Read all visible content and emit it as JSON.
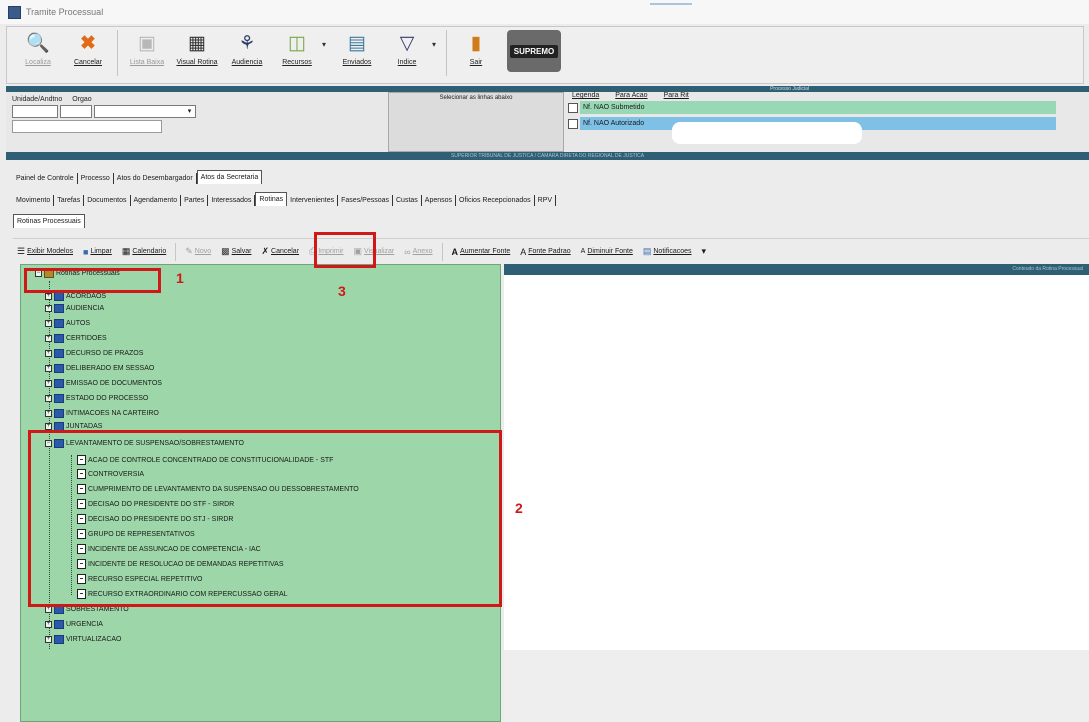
{
  "window": {
    "title": "Tramite Processual"
  },
  "toolbar": {
    "buttons": [
      {
        "label": "Localiza",
        "icon": "magnifier-doc-icon",
        "disabled": true
      },
      {
        "label": "Cancelar",
        "icon": "red-x-icon",
        "disabled": false
      },
      {
        "label": "Lista Baixa",
        "icon": "books-icon",
        "disabled": true
      },
      {
        "label": "Visual Rotina",
        "icon": "document-view-icon",
        "disabled": false
      },
      {
        "label": "Audiencia",
        "icon": "people-icon",
        "disabled": false
      },
      {
        "label": "Recursos",
        "icon": "folders-icon",
        "disabled": false
      },
      {
        "label": "Enviados",
        "icon": "send-document-icon",
        "disabled": false
      },
      {
        "label": "Indice",
        "icon": "funnel-icon",
        "disabled": false
      },
      {
        "label": "Sair",
        "icon": "exit-door-icon",
        "disabled": false
      }
    ],
    "logo_text": "SUPREMO"
  },
  "header": {
    "banner": "Processo Judicial",
    "labels": [
      "Unidade/Andtno",
      "Orgao"
    ],
    "mid_header": "Selecionar as linhas abaixo",
    "legend_cols": [
      "Legenda",
      "Para Acao",
      "Para Rit"
    ],
    "legend_rows": [
      "Nf. NAO Submetido",
      "Nf. NAO Autorizado"
    ]
  },
  "band_text": "SUPERIOR TRIBUNAL DE JUSTICA / CAMARA DIRETA DO REGIONAL DE JUSTICA",
  "tabs_row1": [
    "Painel de Controle",
    "Processo",
    "Atos do Desembargador",
    "Atos da Secretaria"
  ],
  "tabs_row2": [
    "Movimento",
    "Tarefas",
    "Documentos",
    "Agendamento",
    "Partes",
    "Interessados",
    "Rotinas",
    "Intervenientes",
    "Fases/Pessoas",
    "Custas",
    "Apensos",
    "Oficios Recepcionados",
    "RPV"
  ],
  "tabs_row3": [
    "Rotinas Processuais"
  ],
  "actions": {
    "left": [
      {
        "label": "Exibir Modelos",
        "icon": "list-icon",
        "disabled": false
      },
      {
        "label": "Limpar",
        "icon": "eraser-icon",
        "disabled": false
      },
      {
        "label": "Calendario",
        "icon": "calendar-icon",
        "disabled": false
      }
    ],
    "mid": [
      {
        "label": "Novo",
        "icon": "pencil-icon",
        "disabled": true
      },
      {
        "label": "Salvar",
        "icon": "floppy-icon",
        "disabled": false
      },
      {
        "label": "Cancelar",
        "icon": "cancel-icon",
        "disabled": false
      },
      {
        "label": "Imprimir",
        "icon": "printer-icon",
        "disabled": true
      },
      {
        "label": "Visualizar",
        "icon": "preview-icon",
        "disabled": true
      },
      {
        "label": "Anexo",
        "icon": "clip-icon",
        "disabled": true
      }
    ],
    "right": [
      {
        "label": "Aumentar Fonte",
        "icon": "font-bigger-icon",
        "disabled": false
      },
      {
        "label": "Fonte Padrao",
        "icon": "font-default-icon",
        "disabled": false
      },
      {
        "label": "Diminuir Fonte",
        "icon": "font-smaller-icon",
        "disabled": false
      },
      {
        "label": "Notificacoes",
        "icon": "notification-icon",
        "disabled": false
      }
    ]
  },
  "tree": {
    "root": "Rotinas Processuais",
    "nodes": [
      "ACORDAOS",
      "AUDIENCIA",
      "AUTOS",
      "CERTIDOES",
      "DECURSO DE PRAZOS",
      "DELIBERADO EM SESSAO",
      "EMISSAO DE DOCUMENTOS",
      "ESTADO DO PROCESSO",
      "INTIMACOES NA CARTEIRO",
      "JUNTADAS",
      "LEVANTAMENTO DE SUSPENSAO/SOBRESTAMENTO",
      "ACAO DE CONTROLE CONCENTRADO DE CONSTITUCIONALIDADE - STF",
      "CONTROVERSIA",
      "CUMPRIMENTO DE LEVANTAMENTO DA SUSPENSAO OU DESSOBRESTAMENTO",
      "DECISAO DO PRESIDENTE DO STF - SIRDR",
      "DECISAO DO PRESIDENTE DO STJ - SIRDR",
      "GRUPO DE REPRESENTATIVOS",
      "INCIDENTE DE ASSUNCAO DE COMPETENCIA - IAC",
      "INCIDENTE DE RESOLUCAO DE DEMANDAS REPETITIVAS",
      "RECURSO ESPECIAL REPETITIVO",
      "RECURSO EXTRAORDINARIO COM REPERCUSSAO GERAL",
      "SOBRESTAMENTO",
      "URGENCIA",
      "VIRTUALIZACAO"
    ]
  },
  "annotations": {
    "mark1": "1",
    "mark2": "2",
    "mark3": "3"
  },
  "editor": {
    "header": "Conteudo da Rotina Processual"
  }
}
